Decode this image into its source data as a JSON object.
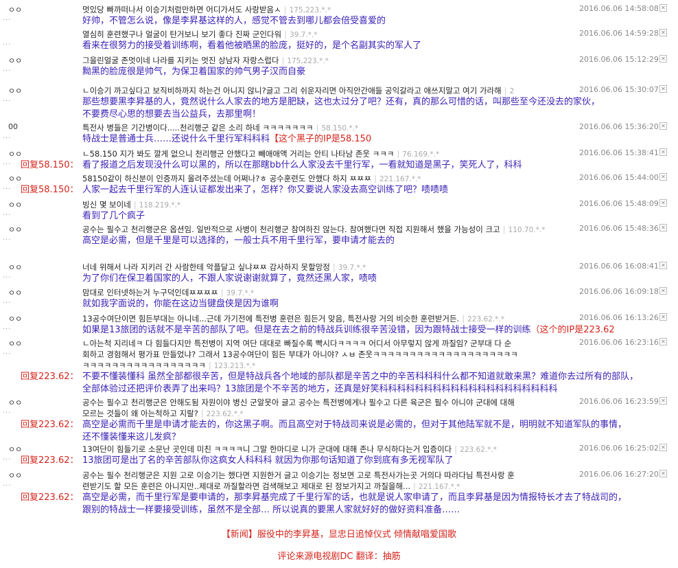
{
  "rows": [
    {
      "user": "ㅇㅇ",
      "ko": "멋있당 빠까떠나서 이승기처럼만하면 어디가서도 사랑받음ㅅ",
      "meta": "175,223.*.*",
      "ts": "2016.06.06 14:58:08",
      "zh": "好帅，不管怎么说，像是李昇基这样的人，感觉不管去到哪儿都会倍受喜爱的"
    },
    {
      "user": "",
      "ko": "열심히 훈련했구나 얼굴이 탄거보니 보기 좋다 진짜 군인다워",
      "meta": "39.7.*.*",
      "ts": "2016.06.06 14:59:28",
      "zh": "看来在很努力的接受着训练啊，看着他被晒黑的脸庞，挺好的，是个名副其实的军人了"
    },
    {
      "user": "ㅇㅇ",
      "ko": "그을린얼굴 존멋이네 나라를 지키는 멋진 상남자 자랑스럽다",
      "meta": "175,223.*.*",
      "ts": "2016.06.06 15:12:29",
      "zh": "黝黑的脸庞很是帅气，为保卫着国家的帅气男子汉而自豪"
    },
    {
      "user": "ㅇㅇ",
      "ko": "ㄴ이승기 까고싶다고 보직비하까지 하는건 아니지 않니?글고 그리 쉬운자리면 아직안간애들 공익갈라고 애쓰지말고 여기 가라해",
      "meta": "2",
      "ts": "2016.06.06 15:30:07",
      "zh": "那些想要黑李昇基的人，竟然说什么人家去的地方是肥缺，这也太过分了吧？还有，真的那么可惜的话，叫那些至今还没去的家伙，",
      "zh2": "不要费尽心思的想要去当公益兵，去那里啊！"
    },
    {
      "user": "00",
      "ko": "특전사 병들은 기간병이다.....천리행군 같은 소리 하네 ㅋㅋㅋㅋㅋㅋㅋ",
      "meta": "58.150.*.*",
      "ts": "2016.06.06 15:36:20",
      "zh": "特战士是普通士兵……还说什么千里行军科科科",
      "zhred": "【这个黑子的IP是58.150"
    },
    {
      "user": "ㅇㅇ",
      "ko": "ㄴ58.150 지가 봐도 깔게 없으니 천리행군 안했다고 빼애애액 거리는 안티 나타남 존웃 ㅋㅋㅋ",
      "meta": "76.169.*.*",
      "ts": "2016.06.06 15:38:41",
      "reply": "回复58.150：",
      "zh": "看了报道之后发现没什么可以黑的，所以在那瞎bb什么人家没去千里行军，一看就知道是黑子，笑死人了，科科"
    },
    {
      "user": "ㅇㅇ",
      "ko": "58150같이 하신분이 인증까지 올려주셨는데 어쩌나?ㅎ 공수훈련도 안했다 하지 ㅉㅉㅉ",
      "meta": "221.167.*.*",
      "ts": "2016.06.06 15:44:00",
      "reply": "回复58.150：",
      "zh": "人家一起去千里行军的人连认证都发出来了，怎样？你又要说人家没去高空训练了吧？啧啧啧"
    },
    {
      "user": "ㅇㅇ",
      "ko": "빙신 몇 보이네",
      "meta": "118.219.*.*",
      "ts": "2016.06.06 15:48:09",
      "zh": "看到了几个疯子"
    },
    {
      "user": "ㅇㅇ",
      "ko": "공수는 필수고 천리행군은 옵션임. 일반적으로 사병이 천리행군 참여하진 않는다. 참여했다면 직접 지원해서 했을 가능성이 크고",
      "meta": "110.70.*.*",
      "ts": "2016.06.06 15:48:36",
      "zh": "高空是必需，但是千里是可以选择的，一般士兵不用千里行军，要申请才能去的"
    },
    {
      "user": "ㅇㅇ",
      "ko": "너네 위해서 나라 지키러 간 사람한테 악플달고 싶냐ㅉㅉ 감사하지 못할망정",
      "meta": "39.7.*.*",
      "ts": "2016.06.06 16:08:41",
      "zh": "为了你们在保卫着国家的人，不跟人家说谢谢就算了，竟然还黑人家，啧啧"
    },
    {
      "user": "ㅇㅇ",
      "ko": "맘대로 인터넷하는거 누구덕인데ㅉㅉㅉㅉ",
      "meta": "39.7.*.*",
      "ts": "2016.06.06 16:09:18",
      "zh": "就如我字面说的，你能在这边当键盘侠是因为谁啊"
    },
    {
      "user": "ㅇㅇ",
      "ko": "13공수여단이면 힘든부대는 아니네...근데 가기전에 특전병 훈련은 힘든거 맞음, 특전사랑 거의 비슷한 훈련받거든.",
      "meta": "223.62.*.*",
      "ts": "2016.06.06 16:13:26",
      "zh": "如果是13旅团的话就不是辛苦的部队了吧。但是在去之前的特战兵训练很辛苦没错，因为跟特战士接受一样的训练",
      "zhred": "（这个的IP是223.62"
    },
    {
      "user": "ㅇㅇ",
      "ko": "ㄴ아는척 지리네ㅋ 다 힘들다지만 특전병이 지역 여단 대대로 빠질수록 빡시다ㅋㅋㅋㅋ 어디서 아무렇지 않게 까질임? 군부대 다 순",
      "ko2": "회하고 경험해서 평가표 만들었냐? 그래서 13공수여단이 힘든 부대가 아니야? ㅅㅂ 존웃ㅋㅋㅋㅋㅋㅋㅋㅋㅋㅋㅋㅋㅋㅋㅋㅋㅋㅋㅋㅋ",
      "ko3": "ㅋㅋㅋㅋㅋㅋㅋㅋㅋㅋㅋㅋㅋㅋㅋㅋㅋ",
      "meta": "123.213.*.*",
      "ts": "2016.06.06 16:23:16",
      "reply": "回复223.62：",
      "zh": "不要不懂装懂科 虽然全部都很辛苦，但是特战兵各个地域的部队都是辛苦之中的辛苦科科科什么都不知道就敢来黑？难道你去过所有的部队，",
      "zh2": "全部体验过还把评价表弄了出来吗？13旅团是个不辛苦的地方，还真是好笑科科科科科科科科科科科科科科科科科科科科"
    },
    {
      "user": "ㅇㅇ",
      "ko": "공수는 필수고 천리행군은 안해도됨 자원이야 병신 군알못아 글고 공수는 특전병에게나 필수고 다른 육군은 필수 아니야 군대에 대해",
      "ko2": "모르는 것들이 왜 아는척하고 지랄?",
      "meta": "223.62.*.*",
      "ts": "2016.06.06 16:23:59",
      "reply": "回复223.62：",
      "zh": "高空是必需而千里是申请才能去的，你这黑子啊。而且高空对于特战司来说是必需的，但对于其他陆军就不是，明明就不知道军队的事情，",
      "zh2": "还不懂装懂来这儿发疯？"
    },
    {
      "user": "ㅇㅇ",
      "ko": "13여단이 힘들기로 소문난 곳인데 미친 ㅋㅋㅋㅋ니 그말 한마디로 니가 군대에 대해 존나 무식하다는거 입증이다",
      "meta": "223.62.*.*",
      "ts": "2016.06.06 16:25:02",
      "reply": "回复223.62：",
      "zh": "13旅团可是出了名的辛苦部队你这疯女人科科科 就因为你那句话知道了你到底有多无视军队了"
    },
    {
      "user": "ㅇㅇ",
      "ko": "공수는 필수 천리행군은 지원 고로 이승기는 했다면 지원한거 글고 이승기는 정보면 고로 특전사가는곳 거의다 따라다님 특전사랑 훈",
      "ko2": "련받기도 할 모든 훈련은 아니지만..제대로 까질할라면 검색해보고 제대로 된 정보가지고 까질을해...",
      "meta": "221.167.*.*",
      "ts": "2016.06.06 16:27:20",
      "reply": "回复223.62：",
      "zh": "高空是必需，而千里行军是要申请的，那李昇基完成了千里行军的话，也就是说人家申请了，而且李昇基是因为情报特长才去了特战司的，",
      "zh2": "跟别的特战士一样要接受训练，虽然不是全部… 所以说真的要黑人家就好好的做好资料准备……"
    }
  ],
  "footer": {
    "news": "【新闻】服役中的李昇基，显忠日追悼仪式 倾情献唱爱国歌",
    "credit": "评论来源电视剧DC  翻译：抽筋"
  },
  "icons": {
    "close": "close-icon"
  },
  "colors": {
    "translation": "#3a23b4",
    "reply": "#d4241c",
    "timestamp": "#888888"
  }
}
